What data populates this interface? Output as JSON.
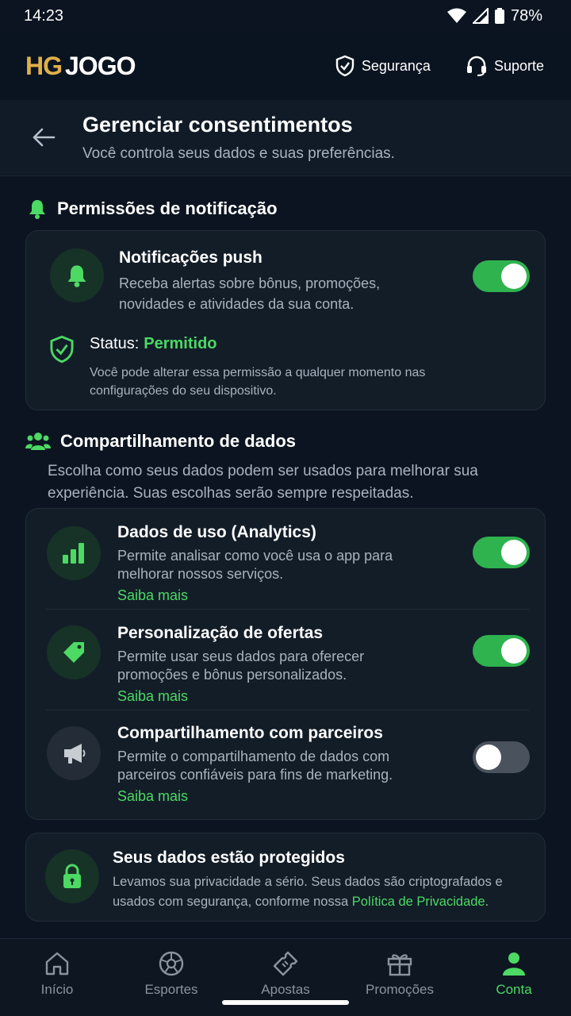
{
  "status_bar": {
    "time": "14:23",
    "battery": "78%"
  },
  "appbar": {
    "logo_hg": "HG",
    "logo_jogo": "JOGO",
    "security_label": "Segurança",
    "support_label": "Suporte"
  },
  "header": {
    "title": "Gerenciar consentimentos",
    "subtitle": "Você controla seus dados e suas preferências."
  },
  "notifications": {
    "section_title": "Permissões de notificação",
    "push_title": "Notificações push",
    "push_desc": "Receba alertas sobre bônus, promoções, novidades e atividades da sua conta.",
    "push_enabled": true,
    "status_label": "Status:",
    "status_value": "Permitido",
    "status_note": "Você pode alterar essa permissão a qualquer momento nas configurações do seu dispositivo."
  },
  "data_sharing": {
    "section_title": "Compartilhamento de dados",
    "intro": "Escolha como seus dados podem ser usados para melhorar sua experiência. Suas escolhas serão sempre respeitadas.",
    "items": [
      {
        "title": "Dados de uso (Analytics)",
        "desc": "Permite analisar como você usa o app para melhorar nossos serviços.",
        "link": "Saiba mais",
        "enabled": true,
        "icon": "bar-chart-icon"
      },
      {
        "title": "Personalização de ofertas",
        "desc": "Permite usar seus dados para oferecer promoções e bônus personalizados.",
        "link": "Saiba mais",
        "enabled": true,
        "icon": "tag-icon"
      },
      {
        "title": "Compartilhamento com parceiros",
        "desc": "Permite o compartilhamento de dados com parceiros confiáveis para fins de marketing.",
        "link": "Saiba mais",
        "enabled": false,
        "icon": "megaphone-icon"
      }
    ]
  },
  "protection": {
    "title": "Seus dados estão protegidos",
    "desc": "Levamos sua privacidade a sério. Seus dados são criptografados e usados com segurança, conforme nossa",
    "policy_link": "Política de Privacidade",
    "period": "."
  },
  "bottom_nav": {
    "items": [
      {
        "label": "Início",
        "icon": "home-icon"
      },
      {
        "label": "Esportes",
        "icon": "ball-icon"
      },
      {
        "label": "Apostas",
        "icon": "ticket-icon"
      },
      {
        "label": "Promoções",
        "icon": "gift-icon"
      },
      {
        "label": "Conta",
        "icon": "user-icon",
        "active": true
      }
    ]
  },
  "colors": {
    "accent": "#4cd964",
    "background": "#0b1420",
    "card": "#131d28",
    "logo_gold": "#e0b04a"
  }
}
